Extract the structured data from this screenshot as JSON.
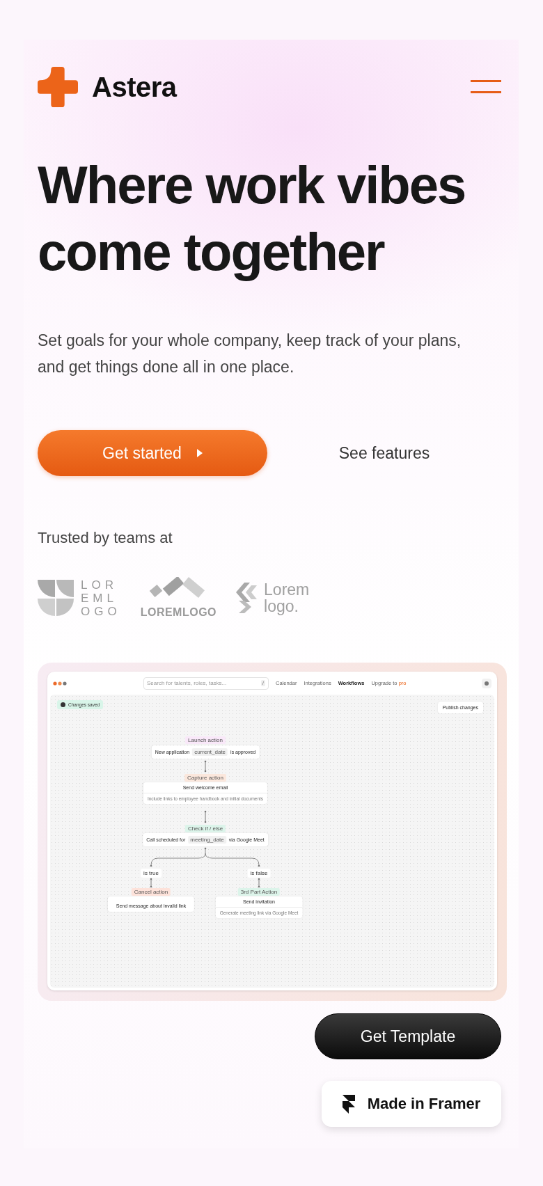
{
  "header": {
    "brand": "Astera"
  },
  "hero": {
    "title": "Where work vibes come together",
    "subtitle": "Set goals for your whole company, keep track of your plans, and get things done all in one place.",
    "primary_button": "Get started",
    "secondary_link": "See features"
  },
  "trusted_label": "Trusted by teams at",
  "logos": [
    {
      "kind": "quarters",
      "lines": [
        "LOR",
        "EML",
        "OGO"
      ]
    },
    {
      "kind": "blocks",
      "lines": [
        "LOREMLOGO"
      ]
    },
    {
      "kind": "chevrons",
      "lines": [
        "Lorem",
        "logo."
      ]
    }
  ],
  "app_preview": {
    "search_placeholder": "Search for talents, roles, tasks...",
    "search_key": "/",
    "nav": [
      {
        "label": "Calendar",
        "selected": false
      },
      {
        "label": "Integrations",
        "selected": false
      },
      {
        "label": "Workflows",
        "selected": true
      }
    ],
    "upgrade_text": "Upgrade to",
    "upgrade_highlight": "pro",
    "status": "Changes saved",
    "publish_button": "Publish changes",
    "flow": [
      {
        "kind": "inline",
        "tag": "Launch action",
        "color": "#f9e8f9",
        "text_before": "New application",
        "variable": "current_date",
        "text_after": "is approved"
      },
      {
        "kind": "card",
        "tag": "Capture action",
        "color": "#fbe7dc",
        "title": "Send welcome email",
        "description": "Include links to employee handbook and initial documents"
      },
      {
        "kind": "inline",
        "tag": "Check if / else",
        "color": "#dcf4ea",
        "text_before": "Call scheduled for",
        "variable": "meeting_date",
        "text_after": "via Google Meet"
      }
    ],
    "branches": [
      {
        "condition": "is true",
        "kind": "simple",
        "tag": "Cancel action",
        "color": "#fde2da",
        "title": "Send message about invalid link"
      },
      {
        "condition": "is false",
        "kind": "card",
        "tag": "3rd Part Action",
        "color": "#dcf4ea",
        "title": "Send invitation",
        "description": "Generate meeting link via Google Meet"
      }
    ]
  },
  "get_template_button": "Get Template",
  "made_in_badge": "Made in Framer"
}
